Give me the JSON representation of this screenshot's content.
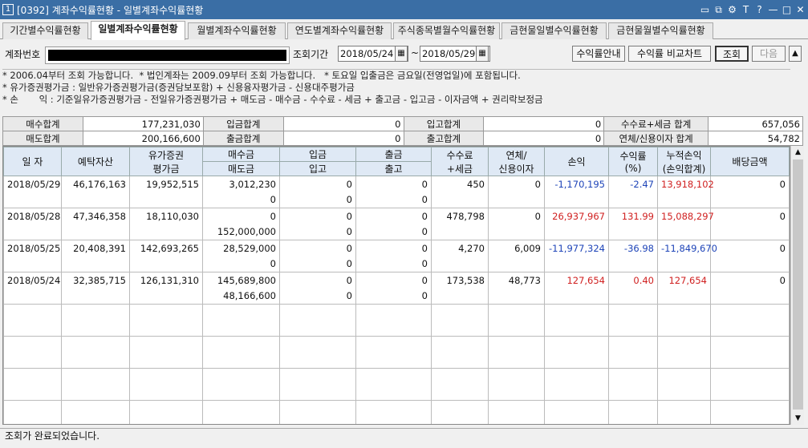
{
  "window": {
    "number": "1",
    "title": "[0392] 계좌수익률현황 - 일별계좌수익률현황",
    "controls": [
      "▭",
      "⧉",
      "⚙",
      "T",
      "?",
      "—",
      "□",
      "✕"
    ]
  },
  "tabs": [
    "기간별수익률현황",
    "일별계좌수익률현황",
    "월별계좌수익률현황",
    "연도별계좌수익률현황",
    "주식종목별월수익률현황",
    "금현물일별수익률현황",
    "금현물월별수익률현황"
  ],
  "cond": {
    "account_label": "계좌번호",
    "period_label": "조회기간",
    "date_from": "2018/05/24",
    "tilde": "~",
    "date_to": "2018/05/29",
    "btn_guide": "수익률안내",
    "btn_compare": "수익률 비교차트",
    "btn_query": "조회",
    "btn_next": "다음",
    "up_arrow": "▲"
  },
  "notes": [
    "* 2006.04부터 조회 가능합니다.  * 법인계좌는 2009.09부터 조회 가능합니다.   * 토요일 입출금은 금요일(전영업일)에 포함됩니다.",
    "* 유가증권평가금 : 일반유가증권평가금(증권담보포함) + 신용융자평가금 - 신용대주평가금",
    "* 손       익 : 기준일유가증권평가금 - 전일유가증권평가금 + 매도금 - 매수금 - 수수료 - 세금 + 출고금 - 입고금 - 이자금액 + 권리락보정금"
  ],
  "summary": [
    [
      "매수합계",
      "177,231,030",
      "입금합계",
      "0",
      "입고합계",
      "0",
      "수수료+세금 합계",
      "657,056"
    ],
    [
      "매도합계",
      "200,166,600",
      "출금합계",
      "0",
      "출고합계",
      "0",
      "연체/신용이자 합계",
      "54,782"
    ]
  ],
  "grid": {
    "headers": {
      "date": "일 자",
      "deposit": "예탁자산",
      "sec1": "유가증권",
      "sec2": "평가금",
      "buy": "매수금",
      "sell": "매도금",
      "in_cash": "입금",
      "in_stock": "입고",
      "out_cash": "출금",
      "out_stock": "출고",
      "fee1": "수수료",
      "fee2": "+세금",
      "int1": "연체/",
      "int2": "신용이자",
      "pnl": "손익",
      "rr1": "수익률",
      "rr2": "(%)",
      "cum1": "누적손익",
      "cum2": "(손익합계)",
      "div": "배당금액"
    },
    "rows": [
      {
        "date": "2018/05/29",
        "deposit": "46,176,163",
        "sec": "19,952,515",
        "buy": "3,012,230",
        "sell": "0",
        "in_cash": "0",
        "in_stock": "0",
        "out_cash": "0",
        "out_stock": "0",
        "fee": "450",
        "int": "0",
        "pnl": "-1,170,195",
        "rr": "-2.47",
        "cum": "13,918,102",
        "div": "0",
        "pnl_color": "blue",
        "rr_color": "blue",
        "cum_color": "red"
      },
      {
        "date": "2018/05/28",
        "deposit": "47,346,358",
        "sec": "18,110,030",
        "buy": "0",
        "sell": "152,000,000",
        "in_cash": "0",
        "in_stock": "0",
        "out_cash": "0",
        "out_stock": "0",
        "fee": "478,798",
        "int": "0",
        "pnl": "26,937,967",
        "rr": "131.99",
        "cum": "15,088,297",
        "div": "0",
        "pnl_color": "red",
        "rr_color": "red",
        "cum_color": "red"
      },
      {
        "date": "2018/05/25",
        "deposit": "20,408,391",
        "sec": "142,693,265",
        "buy": "28,529,000",
        "sell": "0",
        "in_cash": "0",
        "in_stock": "0",
        "out_cash": "0",
        "out_stock": "0",
        "fee": "4,270",
        "int": "6,009",
        "pnl": "-11,977,324",
        "rr": "-36.98",
        "cum": "-11,849,670",
        "div": "0",
        "pnl_color": "blue",
        "rr_color": "blue",
        "cum_color": "blue"
      },
      {
        "date": "2018/05/24",
        "deposit": "32,385,715",
        "sec": "126,131,310",
        "buy": "145,689,800",
        "sell": "48,166,600",
        "in_cash": "0",
        "in_stock": "0",
        "out_cash": "0",
        "out_stock": "0",
        "fee": "173,538",
        "int": "48,773",
        "pnl": "127,654",
        "rr": "0.40",
        "cum": "127,654",
        "div": "0",
        "pnl_color": "red",
        "rr_color": "red",
        "cum_color": "red"
      }
    ],
    "empty_rows": 4
  },
  "scroll": {
    "up": "▲",
    "down": "▼"
  },
  "status": "조회가 완료되었습니다."
}
